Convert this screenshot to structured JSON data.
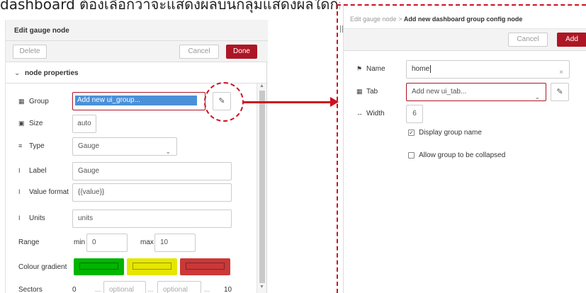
{
  "caption": "dashboard ต้องเลือกว่าจะแสดงผลบนกลุ่มแสดงผลใดก่อนโดย",
  "left_panel": {
    "title": "Edit gauge node",
    "delete_label": "Delete",
    "cancel_label": "Cancel",
    "done_label": "Done",
    "section_label": "node properties",
    "fields": {
      "group_label": "Group",
      "group_value": "Add new ui_group...",
      "size_label": "Size",
      "size_value": "auto",
      "type_label": "Type",
      "type_value": "Gauge",
      "label_label": "Label",
      "label_value": "Gauge",
      "value_format_label": "Value format",
      "value_format_value": "{{value}}",
      "units_label": "Units",
      "units_value": "units",
      "range_label": "Range",
      "range_min_label": "min",
      "range_min_value": "0",
      "range_max_label": "max",
      "range_max_value": "10",
      "colour_gradient_label": "Colour gradient",
      "sectors_label": "Sectors",
      "sectors_start": "0",
      "sectors_sep1": "...",
      "sectors_placeholder1": "optional",
      "sectors_sep2": "...",
      "sectors_placeholder2": "optional",
      "sectors_sep3": "...",
      "sectors_end": "10"
    },
    "gradient_colors": [
      "#00b500",
      "#e6e600",
      "#ca3838"
    ]
  },
  "right_panel": {
    "breadcrumb_parent": "Edit gauge node",
    "breadcrumb_sep": ">",
    "breadcrumb_current": "Add new dashboard group config node",
    "cancel_label": "Cancel",
    "add_label": "Add",
    "name_label": "Name",
    "name_value": "home",
    "tab_label": "Tab",
    "tab_value": "Add new ui_tab...",
    "width_label": "Width",
    "width_value": "6",
    "display_group_name_label": "Display group name",
    "display_group_name_checked": true,
    "allow_collapse_label": "Allow group to be collapsed",
    "allow_collapse_checked": false
  },
  "colors": {
    "accent": "#ad1625",
    "callout": "#cc1020",
    "selection": "#4a90d9"
  }
}
